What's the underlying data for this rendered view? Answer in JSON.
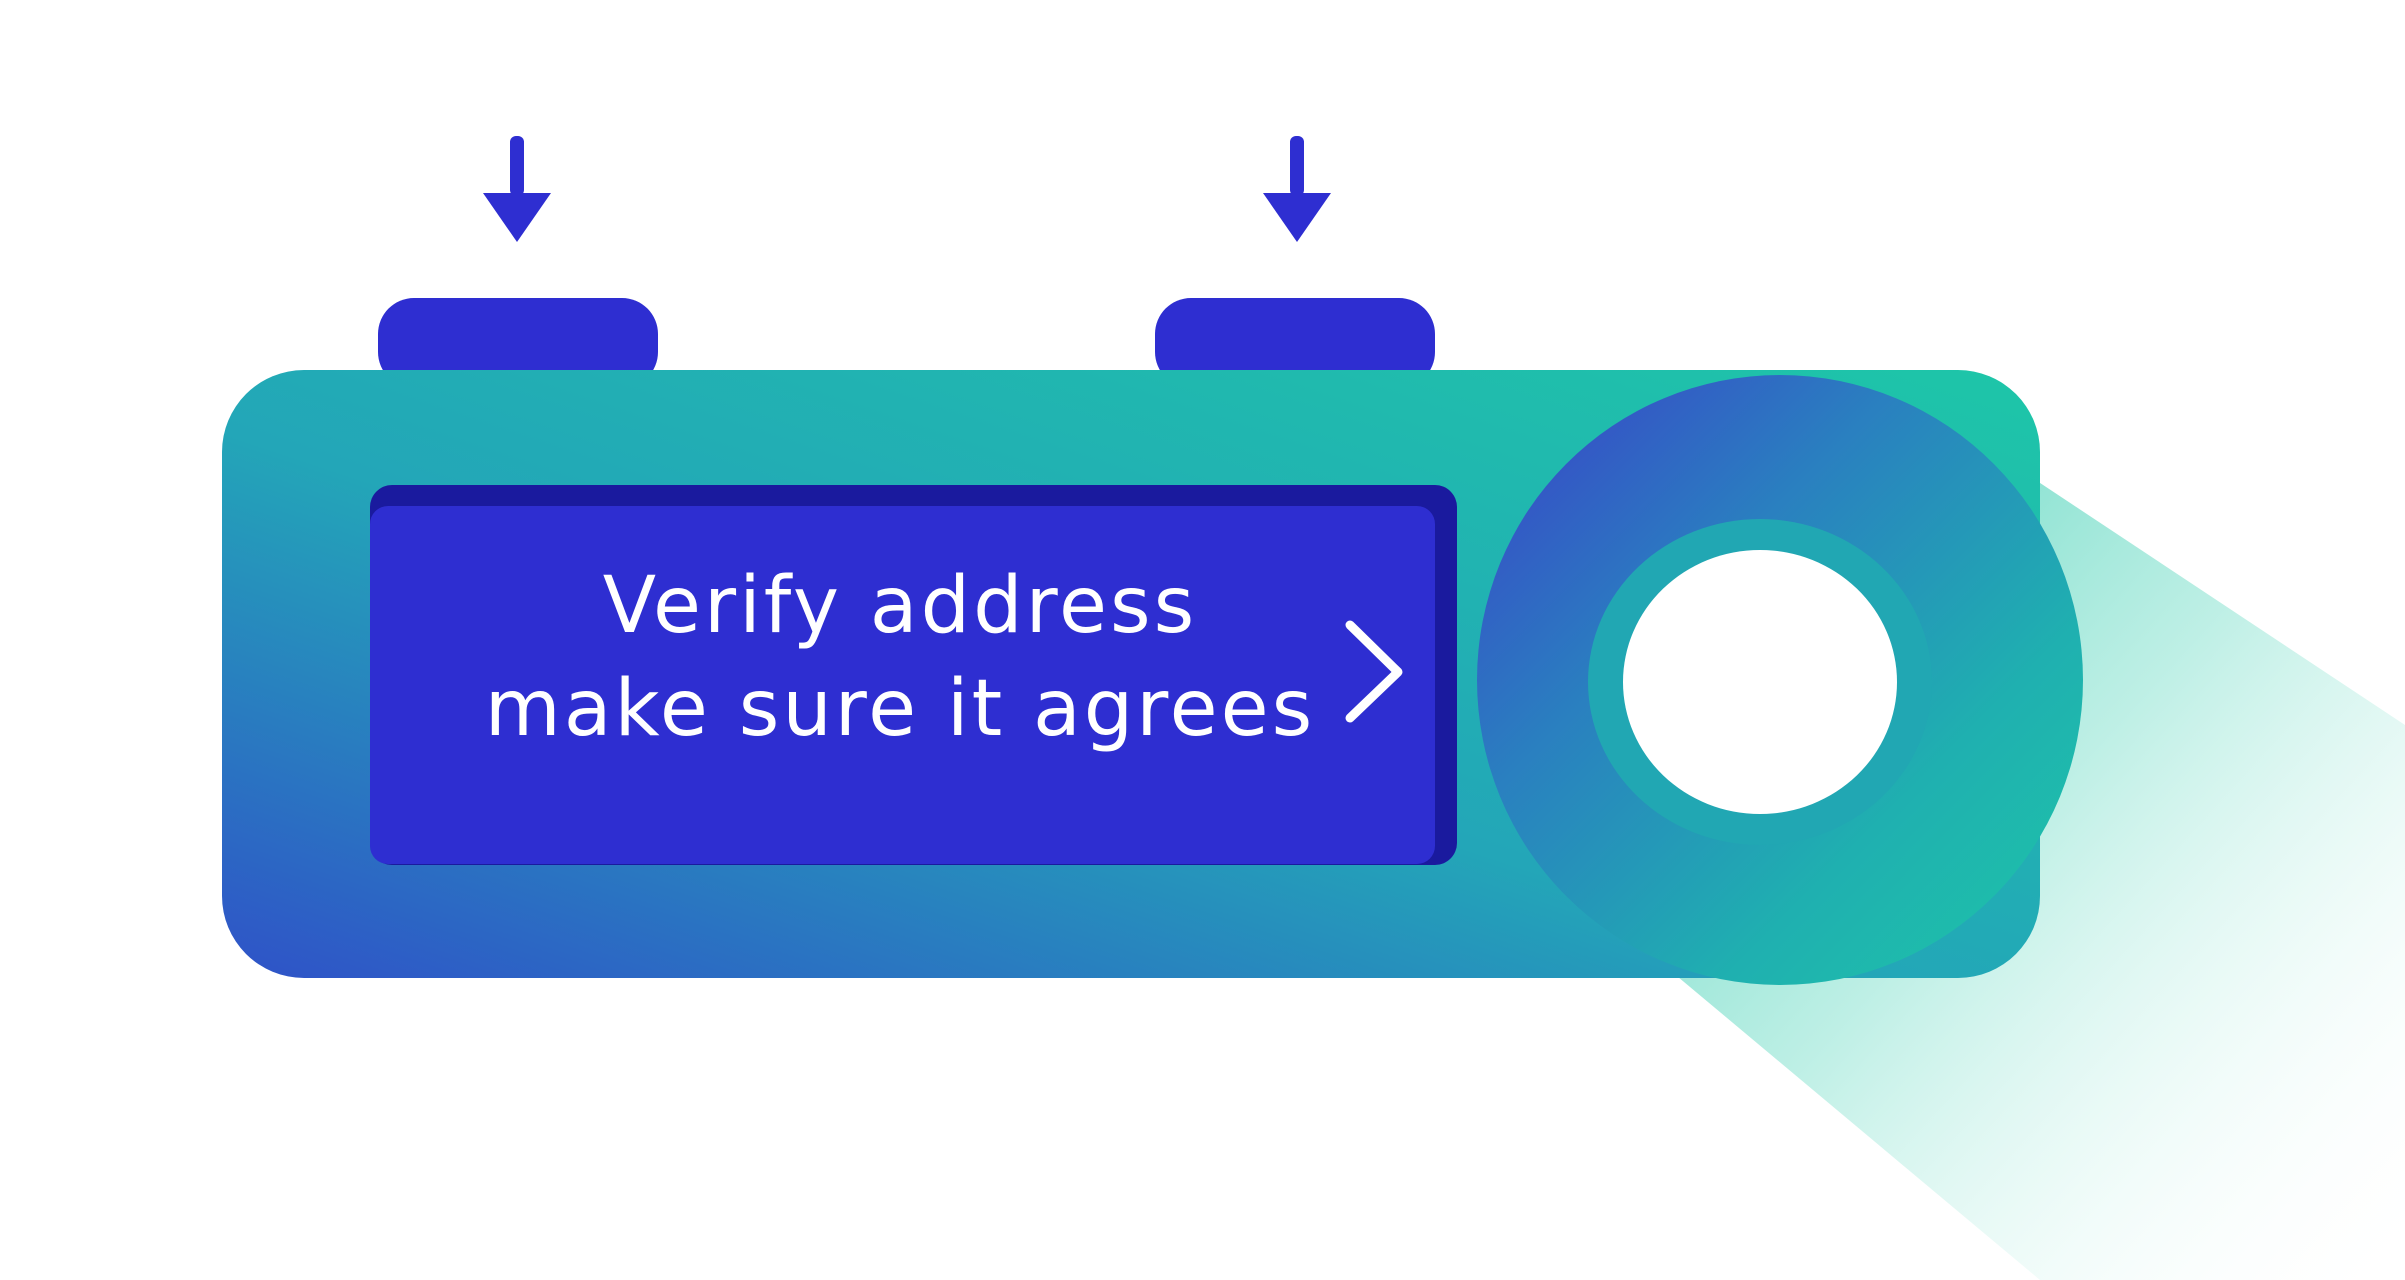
{
  "screen": {
    "line1": "Verify address",
    "line2": "make sure it agrees"
  },
  "icons": {
    "left_button_indicator": "arrow-down-icon",
    "right_button_indicator": "arrow-down-icon",
    "screen_next": "chevron-right-icon"
  },
  "colors": {
    "device_body_start": "#1ec6a8",
    "device_body_end": "#2f52c8",
    "buttons": "#2e2ed1",
    "screen": "#2e2ed1",
    "screen_shadow": "#1a1a9e",
    "arrows": "#2e2ed1",
    "text": "#ffffff",
    "light_beam": "#1ec6a8"
  }
}
